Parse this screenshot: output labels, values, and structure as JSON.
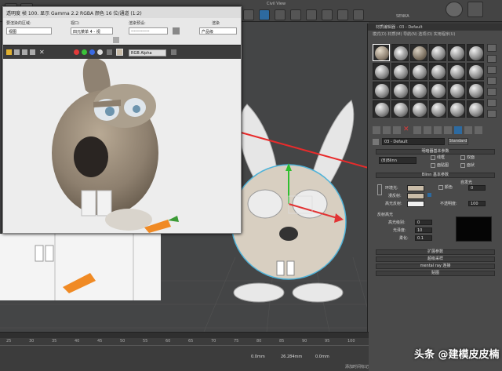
{
  "toolbar": {
    "viewport_label": "Civil View",
    "rightmenu": "SENKA"
  },
  "framebuffer": {
    "title": "透明度 帧 100. 显示 Gamma 2.2 RGBA 颜色 16 位/通道 (1:2)",
    "area_label": "要渲染的区域:",
    "area_value": "视图",
    "viewport_label": "视口:",
    "viewport_value": "四元菜单 4 - 视",
    "preset_label": "渲染预设:",
    "preset_value": "-------------",
    "render_label": "渲染",
    "render_value": "产品级",
    "channel_value": "RGB Alpha"
  },
  "material_editor": {
    "title": "材质编辑器 - 03 - Default",
    "menu": "模式(D)  材质(M)  导航(N)  选项(O)  实用程序(U)",
    "material_name": "03 - Default",
    "material_type": "Standard",
    "rollout_shader": "明暗器基本参数",
    "shader_value": "(B)Blinn",
    "opt_wire": "线框",
    "opt_2side": "双面",
    "opt_facemap": "面贴图",
    "opt_faceted": "面状",
    "rollout_blinn": "Blinn 基本参数",
    "self_illum": "自发光",
    "ambient": "环境光:",
    "diffuse": "漫反射:",
    "specular": "高光反射:",
    "color_label": "颜色",
    "color_value": "0",
    "opacity_label": "不透明度:",
    "opacity_value": "100",
    "specular_hl": "反射高光",
    "spec_level": "高光级别:",
    "spec_level_value": "0",
    "glossiness": "光泽度:",
    "glossiness_value": "10",
    "soften": "柔化:",
    "soften_value": "0.1",
    "rollout_ext": "扩展参数",
    "rollout_ss": "超级采样",
    "rollout_mr": "mental ray 连接",
    "rollout_maps": "贴图",
    "accent_color": "#2d6aa0",
    "diffuse_color": "#c9bca8"
  },
  "timeline": {
    "ticks": [
      "25",
      "30",
      "35",
      "40",
      "45",
      "50",
      "55",
      "60",
      "65",
      "70",
      "75",
      "80",
      "85",
      "90",
      "95",
      "100"
    ],
    "coord_x": "0.0mm",
    "coord_y": "26.284mm",
    "coord_z": "0.0mm",
    "status": "添加时间标记"
  },
  "watermark": "头条 @建模皮皮楠"
}
